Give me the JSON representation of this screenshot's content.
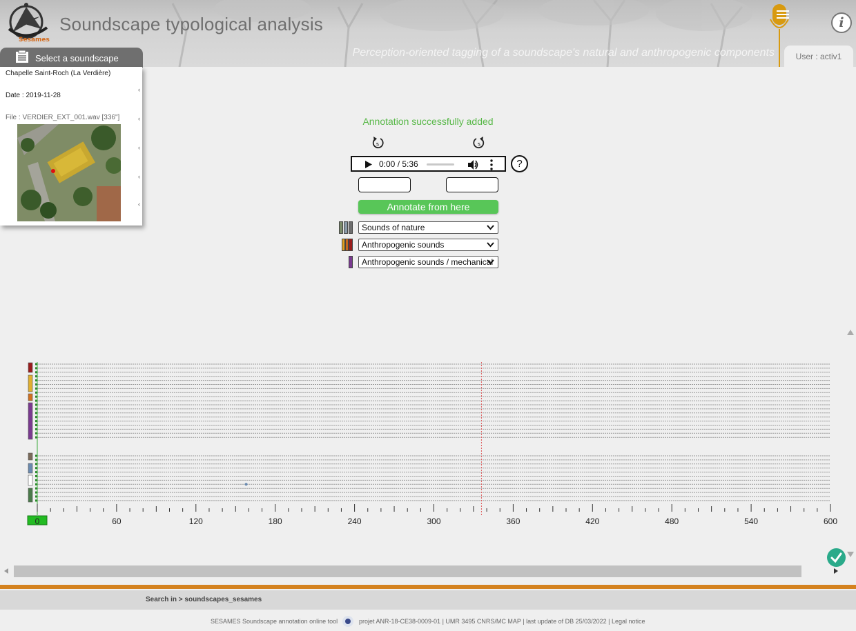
{
  "header": {
    "logo_text": "Sesames",
    "title": "Soundscape typological analysis",
    "subtitle": "Perception-oriented tagging of a soundscape's natural and anthropogenic components",
    "user_label": "User : activ1",
    "info_label": "i"
  },
  "soundscape_panel": {
    "tab_label": "Select a soundscape",
    "place": "Chapelle Saint-Roch (La Verdière)",
    "date": "Date : 2019-11-28",
    "file": "File : VERDIER_EXT_001.wav [336\"]"
  },
  "controls": {
    "status_message": "Annotation successfully added",
    "rewind_back_label": "5",
    "rewind_forward_label": "5",
    "audio_time": "0:00 / 5:36",
    "help_label": "?",
    "start_input_value": "",
    "end_input_value": "",
    "annotate_button": "Annotate from here",
    "selects": [
      {
        "value": "Sounds of nature",
        "colors": [
          "#7a8a6a",
          "#8a9aa8",
          "#6f6f6f"
        ]
      },
      {
        "value": "Anthropogenic sounds",
        "colors": [
          "#e0a020",
          "#c8681c",
          "#9a1c1c"
        ]
      },
      {
        "value": "Anthropogenic sounds / mechanical",
        "colors": [
          "#7a3a90"
        ]
      }
    ]
  },
  "chart_data": {
    "type": "timeline",
    "x_ticks": [
      0,
      60,
      120,
      180,
      240,
      300,
      360,
      420,
      480,
      540,
      600
    ],
    "xlim": [
      0,
      600
    ],
    "minor_tick_step": 10,
    "cursor_time": 336,
    "current_time": 0,
    "annotation_point": {
      "time": 158,
      "row": 26
    },
    "rows_group1": 19,
    "rows_group2": 12,
    "category_colors": [
      "#9a1c1c",
      "#e0b030",
      "#d07020",
      "#7a3a90",
      "#7a6a5a",
      "#6a8ab0",
      "#ffffff",
      "#4a7a4a"
    ]
  },
  "footer": {
    "search_text": "Search in > soundscapes_sesames",
    "left_text": "SESAMES Soundscape annotation online tool",
    "right_text": "projet ANR-18-CE38-0009-01 | UMR 3495 CNRS/MC MAP | last update of DB 25/03/2022 | Legal notice"
  }
}
